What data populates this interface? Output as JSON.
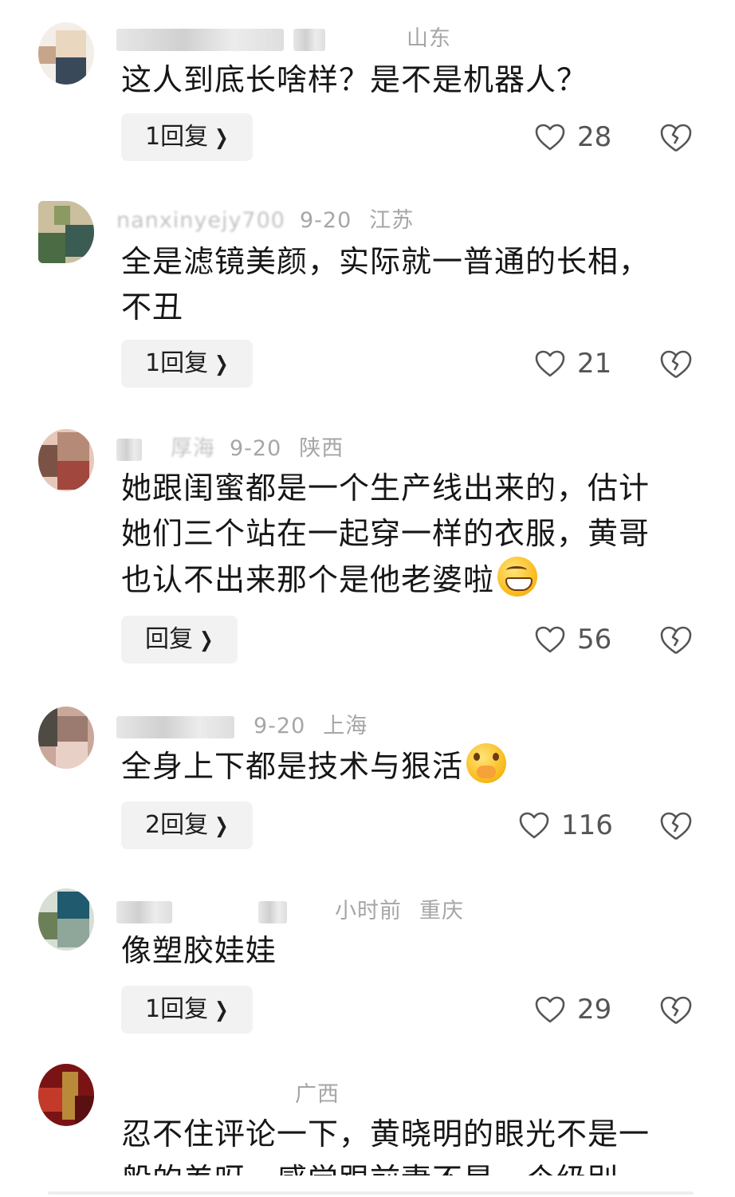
{
  "comments": [
    {
      "author_blurred": "",
      "date": "",
      "location": "山东",
      "text": "这人到底长啥样？是不是机器人？",
      "reply_label": "1回复",
      "likes": "28",
      "avatar_colors": [
        "#ead7c0",
        "#39495a",
        "#c7a58a",
        "#f0f0f0"
      ]
    },
    {
      "author_blurred": "nanxinyejy700",
      "date": "9-20",
      "location": "江苏",
      "text": "全是滤镜美颜，实际就一普通的长相，不丑",
      "reply_label": "1回复",
      "likes": "21",
      "avatar_colors": [
        "#4a6b43",
        "#8b9a60",
        "#cbbfa0",
        "#3a5c52"
      ]
    },
    {
      "author_blurred": "厚海",
      "date": "9-20",
      "location": "陕西",
      "text": "她跟闺蜜都是一个生产线出来的，估计她们三个站在一起穿一样的衣服，黄哥也认不出来那个是他老婆啦",
      "reply_label": "回复",
      "likes": "56",
      "avatar_colors": [
        "#b58a76",
        "#a2473e",
        "#e6c8bb",
        "#7b5246"
      ]
    },
    {
      "author_blurred": "",
      "date": "9-20",
      "location": "上海",
      "text": "全身上下都是技术与狠活",
      "reply_label": "2回复",
      "likes": "116",
      "avatar_colors": [
        "#9b7a70",
        "#e9d0c7",
        "#4f4a44",
        "#c9a79a"
      ]
    },
    {
      "author_blurred": "",
      "date": "小时前",
      "location": "重庆",
      "text": "像塑胶娃娃",
      "reply_label": "1回复",
      "likes": "29",
      "avatar_colors": [
        "#1f5a6e",
        "#8fa79b",
        "#6b7f59",
        "#d7dfd5"
      ]
    },
    {
      "author_blurred": "",
      "date": "",
      "location": "广西",
      "text": "忍不住评论一下，黄晓明的眼光不是一般的差呀，感觉跟前妻不是一个级别",
      "reply_label": "",
      "likes": "",
      "avatar_colors": [
        "#7a1414",
        "#b98a3a",
        "#c43a2a",
        "#5a1010"
      ]
    }
  ],
  "icons": {
    "like": "heart-outline-icon",
    "dislike": "broken-heart-icon",
    "chevron": "chevron-right-icon"
  },
  "colors": {
    "text": "#161616",
    "meta": "#a6a6a6",
    "reply_bg": "#f2f2f2",
    "icon": "#555555"
  }
}
